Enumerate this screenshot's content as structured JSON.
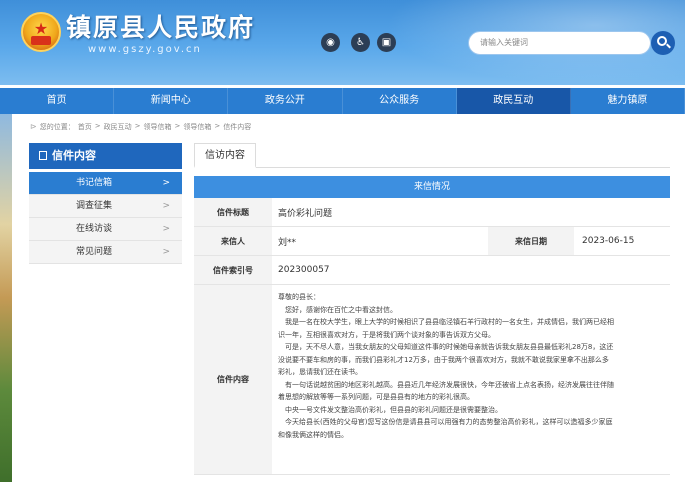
{
  "header": {
    "title": "镇原县人民政府",
    "url": "www.gszy.gov.cn",
    "tools": [
      "◉",
      "♿",
      "▣"
    ],
    "search_placeholder": "请输入关键词"
  },
  "nav": [
    "首页",
    "新闻中心",
    "政务公开",
    "公众服务",
    "政民互动",
    "魅力镇原"
  ],
  "nav_active_index": 4,
  "breadcrumb": {
    "prefix": "您的位置：",
    "items": [
      "首页",
      ">",
      "政民互动",
      ">",
      "领导信箱",
      ">",
      "领导信箱",
      ">",
      "信件内容"
    ]
  },
  "sidebar": {
    "title": "信件内容",
    "items": [
      {
        "label": "书记信箱",
        "arrow": ">"
      },
      {
        "label": "调查征集",
        "arrow": ">"
      },
      {
        "label": "在线访谈",
        "arrow": ">"
      },
      {
        "label": "常见问题",
        "arrow": ">"
      }
    ]
  },
  "main": {
    "tab": "信访内容",
    "section_title": "来信情况",
    "subject_label": "信件标题",
    "subject": "高价彩礼问题",
    "sender_label": "来信人",
    "sender": "刘**",
    "date_label": "来信日期",
    "date": "2023-06-15",
    "index_label": "信件索引号",
    "index": "202300057",
    "content_label": "信件内容",
    "content": [
      "尊敬的县长：",
      "　您好，感谢你在百忙之中看这封信。",
      "　我是一名在校大学生，眼上大学的时候相识了县县临泾镇石羊行政村的一名女生，并成情侣，我们两已经相",
      "识一年，互相很喜欢对方，于是将我们两个谈对象的事告诉双方父母。",
      "　可是，天不尽人意，当我女朋友的父母知道这件事的时候她母亲就告诉我女朋友县县最低彩礼28万8，这还",
      "没说要不要车和房的事，而我们县彩礼才12万多，由于我两个很喜欢对方，我就不敢说我家里拿不出那么多",
      "彩礼，恳请我们还在读书。",
      "　有一句话说越贫困的地区彩礼越高。县县近几年经济发展很快，今年还被省上点名表扬，经济发展往往伴随",
      "着思想的解放等等一系列问题，可是县县有的地方的彩礼很高。",
      "　中央一号文件发文整治高价彩礼，但县县的彩礼问题还是很需要整治。",
      "　今天给县长(西姓的父母官)您写这份信是请县县可以用强有力的态势整治高价彩礼，这样可以造福多少家庭",
      "和像我俩这样的情侣。"
    ]
  }
}
